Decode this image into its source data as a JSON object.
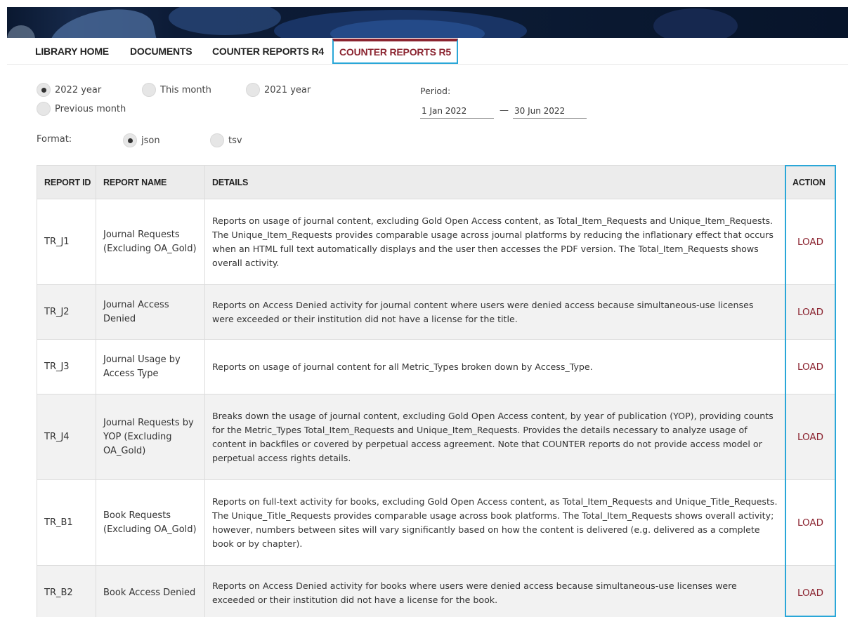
{
  "nav": {
    "items": [
      {
        "label": "LIBRARY HOME"
      },
      {
        "label": "DOCUMENTS"
      },
      {
        "label": "COUNTER REPORTS R4"
      },
      {
        "label": "COUNTER REPORTS R5"
      }
    ],
    "active_index": 3
  },
  "period_options": [
    {
      "label": "2022 year",
      "selected": true
    },
    {
      "label": "This month",
      "selected": false
    },
    {
      "label": "2021 year",
      "selected": false
    },
    {
      "label": "Previous month",
      "selected": false
    }
  ],
  "period": {
    "label": "Period:",
    "start": "1 Jan 2022",
    "separator": "—",
    "end": "30 Jun 2022"
  },
  "format": {
    "label": "Format:",
    "options": [
      {
        "label": "json",
        "selected": true
      },
      {
        "label": "tsv",
        "selected": false
      }
    ]
  },
  "table": {
    "headers": [
      "REPORT ID",
      "REPORT NAME",
      "DETAILS",
      "ACTION"
    ],
    "rows": [
      {
        "id": "TR_J1",
        "name": "Journal Requests (Excluding OA_Gold)",
        "details": "Reports on usage of journal content, excluding Gold Open Access content, as Total_Item_Requests and Unique_Item_Requests. The Unique_Item_Requests provides comparable usage across journal platforms by reducing the inflationary effect that occurs when an HTML full text automatically displays and the user then accesses the PDF version. The Total_Item_Requests shows overall activity.",
        "action": "LOAD"
      },
      {
        "id": "TR_J2",
        "name": "Journal Access Denied",
        "details": "Reports on Access Denied activity for journal content where users were denied access because simultaneous-use licenses were exceeded or their institution did not have a license for the title.",
        "action": "LOAD"
      },
      {
        "id": "TR_J3",
        "name": "Journal Usage by Access Type",
        "details": "Reports on usage of journal content for all Metric_Types broken down by Access_Type.",
        "action": "LOAD"
      },
      {
        "id": "TR_J4",
        "name": "Journal Requests by YOP (Excluding OA_Gold)",
        "details": "Breaks down the usage of journal content, excluding Gold Open Access content, by year of publication (YOP), providing counts for the Metric_Types Total_Item_Requests and Unique_Item_Requests. Provides the details necessary to analyze usage of content in backfiles or covered by perpetual access agreement. Note that COUNTER reports do not provide access model or perpetual access rights details.",
        "action": "LOAD"
      },
      {
        "id": "TR_B1",
        "name": "Book Requests (Excluding OA_Gold)",
        "details": "Reports on full-text activity for books, excluding Gold Open Access content, as Total_Item_Requests and Unique_Title_Requests. The Unique_Title_Requests provides comparable usage across book platforms. The Total_Item_Requests shows overall activity; however, numbers between sites will vary significantly based on how the content is delivered (e.g. delivered as a complete book or by chapter).",
        "action": "LOAD"
      },
      {
        "id": "TR_B2",
        "name": "Book Access Denied",
        "details": "Reports on Access Denied activity for books where users were denied access because simultaneous-use licenses were exceeded or their institution did not have a license for the book.",
        "action": "LOAD"
      }
    ]
  },
  "colors": {
    "accent": "#8b2430",
    "highlight": "#2aa7d8",
    "header_bg": "#ececec",
    "row_alt_bg": "#f2f2f2"
  }
}
